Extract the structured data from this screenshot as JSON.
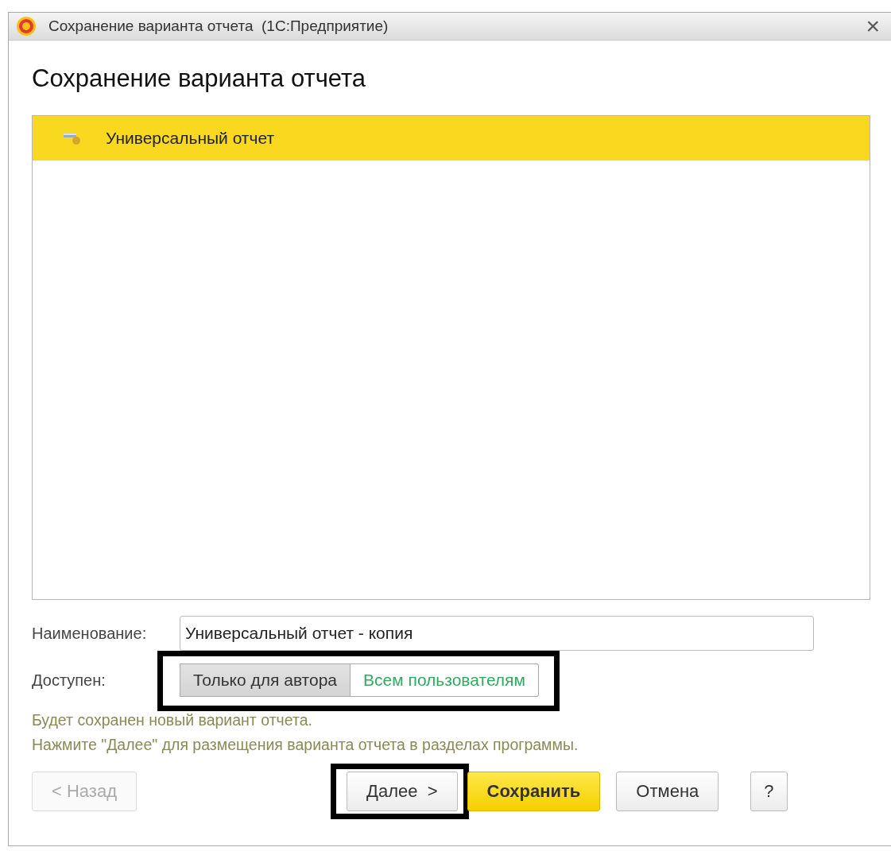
{
  "window": {
    "title": "Сохранение варианта отчета  (1С:Предприятие)",
    "close": "×"
  },
  "heading": "Сохранение варианта отчета",
  "list": {
    "items": [
      {
        "label": "Универсальный отчет",
        "selected": true
      }
    ]
  },
  "name_field": {
    "label": "Наименование:",
    "value": "Универсальный отчет - копия"
  },
  "availability": {
    "label": "Доступен:",
    "highlighted": true,
    "options": [
      {
        "label": "Только для автора",
        "selected": true
      },
      {
        "label": "Всем пользователям",
        "selected": false
      }
    ]
  },
  "info": [
    "Будет сохранен новый вариант отчета.",
    "Нажмите \"Далее\" для размещения варианта отчета в разделах программы."
  ],
  "buttons": [
    {
      "kind": "back",
      "label": "< Назад",
      "disabled": true,
      "highlighted": false
    },
    {
      "kind": "next",
      "label": "Далее  >",
      "disabled": false,
      "highlighted": true
    },
    {
      "kind": "default",
      "label": "Сохранить",
      "disabled": false,
      "highlighted": false
    },
    {
      "kind": "plain",
      "label": "Отмена",
      "disabled": false,
      "highlighted": false
    },
    {
      "kind": "help",
      "label": "?",
      "disabled": false,
      "highlighted": false
    }
  ]
}
